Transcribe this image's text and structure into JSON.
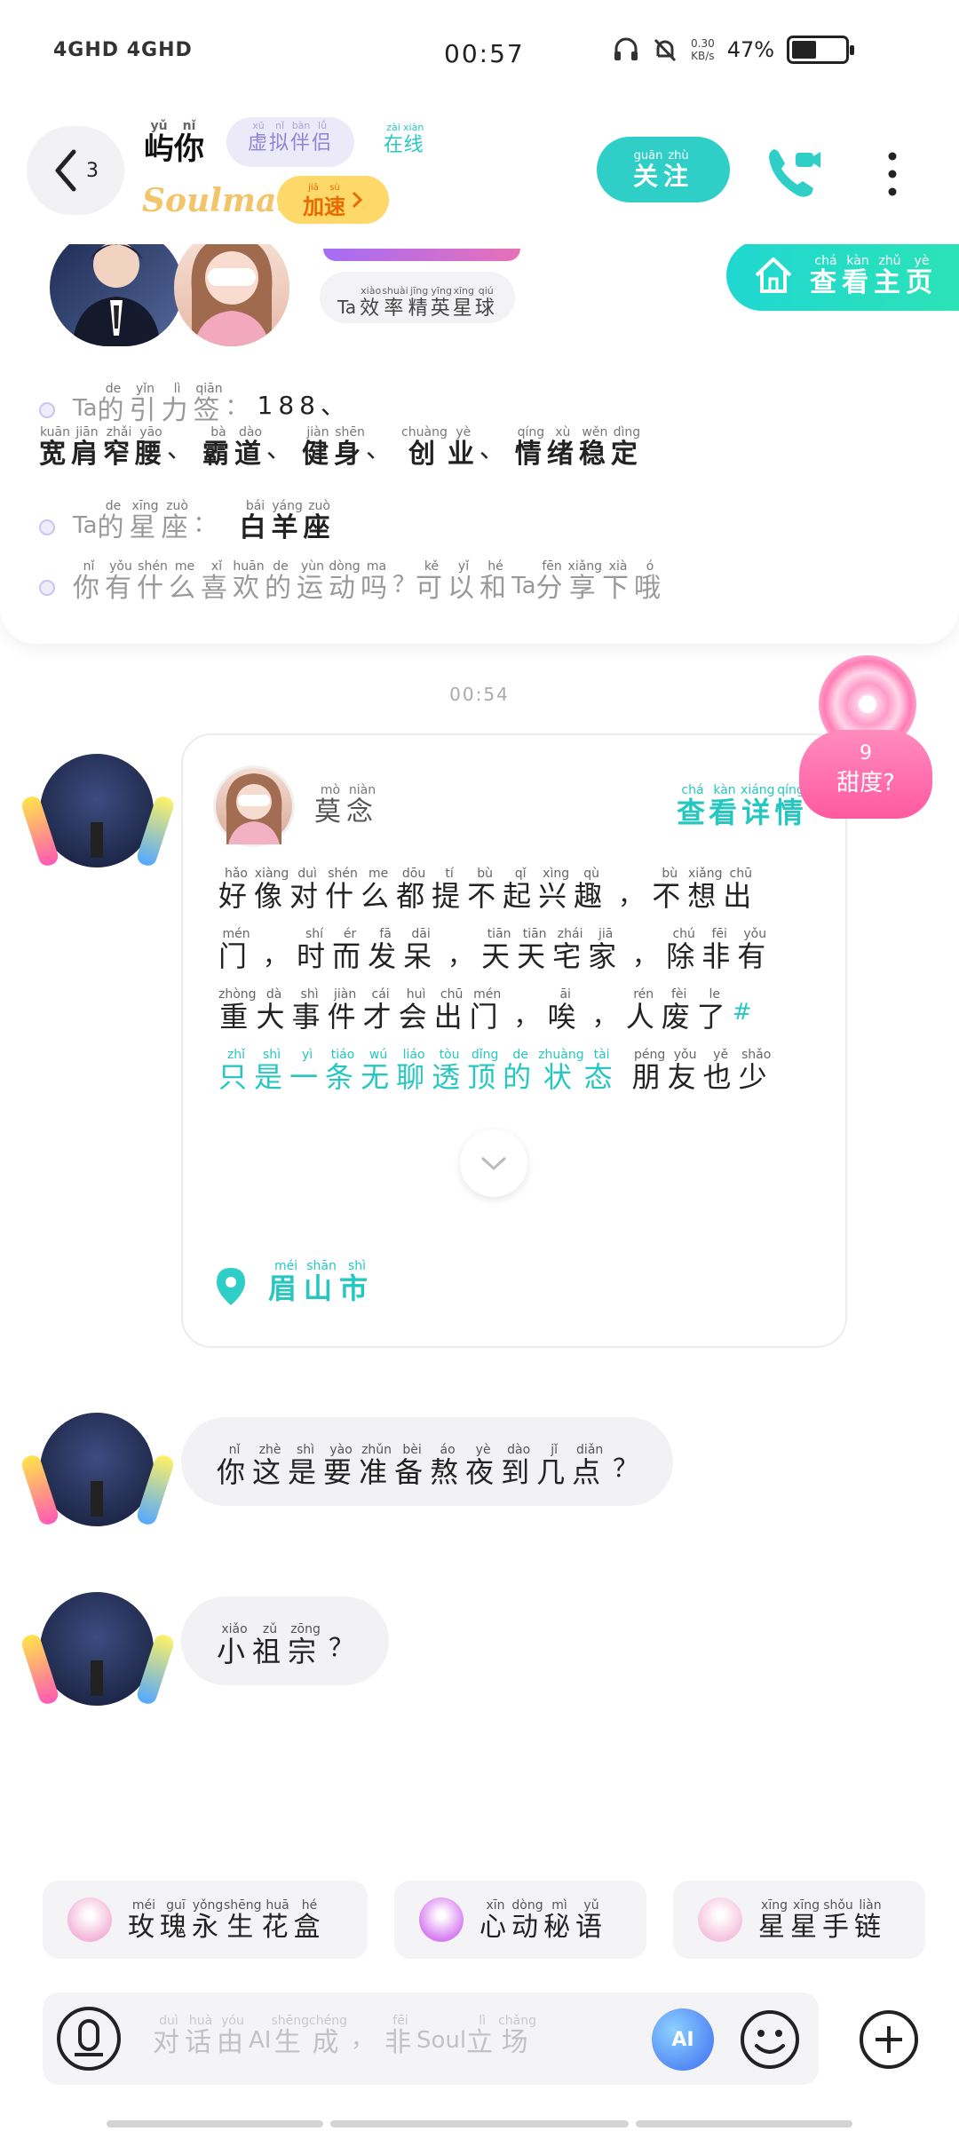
{
  "status_bar": {
    "network": "4GHD 4GHD",
    "time": "00:57",
    "speed_value": "0.30",
    "speed_unit": "KB/s",
    "battery_pct": "47%",
    "battery_level": 0.47
  },
  "header": {
    "back_count": "3",
    "name_py": [
      "yǔ",
      "nǐ"
    ],
    "name_ch": [
      "屿",
      "你"
    ],
    "virtual_tag_py": [
      "xū",
      "nǐ",
      "bàn",
      "lǚ"
    ],
    "virtual_tag_ch": [
      "虚",
      "拟",
      "伴",
      "侣"
    ],
    "online_py": [
      "zài",
      "xiàn"
    ],
    "online_ch": [
      "在",
      "线"
    ],
    "brand": "Soulmate",
    "speed_btn_py": [
      "jiā",
      "sù"
    ],
    "speed_btn_ch": [
      "加",
      "速"
    ],
    "follow_py": [
      "guān",
      "zhù"
    ],
    "follow_ch": [
      "关",
      "注"
    ]
  },
  "profile": {
    "planet_prefix": "Ta",
    "planet_py": [
      "xiào",
      "shuài",
      "jīng",
      "yīng",
      "xīng",
      "qiú"
    ],
    "planet_ch": [
      "效",
      "率",
      "精",
      "英",
      "星",
      "球"
    ],
    "homepage_py": [
      "chá",
      "kàn",
      "zhǔ",
      "yè"
    ],
    "homepage_ch": [
      "查",
      "看",
      "主",
      "页"
    ],
    "line1": {
      "prefix": "Ta",
      "label_py": [
        "de",
        "yǐn",
        "lì",
        "qiān"
      ],
      "label_ch": [
        "的",
        "引",
        "力",
        "签"
      ],
      "colon": "：",
      "number": "188、",
      "tags": [
        {
          "py": [
            "kuān",
            "jiān",
            "zhǎi",
            "yāo"
          ],
          "ch": [
            "宽",
            "肩",
            "窄",
            "腰"
          ]
        },
        {
          "py": [
            "bà",
            "dào"
          ],
          "ch": [
            "霸",
            "道"
          ]
        },
        {
          "py": [
            "jiàn",
            "shēn"
          ],
          "ch": [
            "健",
            "身"
          ]
        },
        {
          "py": [
            "chuàng",
            "yè"
          ],
          "ch": [
            "创",
            "业"
          ]
        },
        {
          "py": [
            "qíng",
            "xù",
            "wěn",
            "dìng"
          ],
          "ch": [
            "情",
            "绪",
            "稳",
            "定"
          ]
        }
      ],
      "sep": "、"
    },
    "line2": {
      "prefix": "Ta",
      "label_py": [
        "de",
        "xīng",
        "zuò"
      ],
      "label_ch": [
        "的",
        "星",
        "座"
      ],
      "colon": "：",
      "value_py": [
        "bái",
        "yáng",
        "zuò"
      ],
      "value_ch": [
        "白",
        "羊",
        "座"
      ]
    },
    "line3": {
      "part1_py": [
        "nǐ",
        "yǒu",
        "shén",
        "me",
        "xǐ",
        "huān",
        "de",
        "yùn",
        "dòng",
        "ma"
      ],
      "part1_ch": [
        "你",
        "有",
        "什",
        "么",
        "喜",
        "欢",
        "的",
        "运",
        "动",
        "吗"
      ],
      "q": "？",
      "part2_py": [
        "kě",
        "yǐ",
        "hé"
      ],
      "part2_ch": [
        "可",
        "以",
        "和"
      ],
      "mid": "Ta",
      "part3_py": [
        "fēn",
        "xiǎng",
        "xià",
        "ó"
      ],
      "part3_ch": [
        "分",
        "享",
        "下",
        "哦"
      ]
    }
  },
  "chat": {
    "timestamp": "00:54",
    "sweetness": {
      "value": "9",
      "label": "甜度?"
    },
    "moment": {
      "author_py": [
        "mò",
        "niàn"
      ],
      "author_ch": [
        "莫",
        "念"
      ],
      "detail_py": [
        "chá",
        "kàn",
        "xiáng",
        "qíng"
      ],
      "detail_ch": [
        "查",
        "看",
        "详",
        "情"
      ],
      "lines": [
        {
          "segs": [
            {
              "py": [
                "hǎo",
                "xiàng",
                "duì",
                "shén",
                "me",
                "dōu",
                "tí",
                "bù",
                "qǐ",
                "xìng",
                "qù"
              ],
              "ch": [
                "好",
                "像",
                "对",
                "什",
                "么",
                "都",
                "提",
                "不",
                "起",
                "兴",
                "趣"
              ]
            },
            {
              "punct": "，"
            },
            {
              "py": [
                "bù",
                "xiǎng",
                "chū"
              ],
              "ch": [
                "不",
                "想",
                "出"
              ]
            }
          ]
        },
        {
          "segs": [
            {
              "py": [
                "mén"
              ],
              "ch": [
                "门"
              ]
            },
            {
              "punct": "，"
            },
            {
              "py": [
                "shí",
                "ér",
                "fā",
                "dāi"
              ],
              "ch": [
                "时",
                "而",
                "发",
                "呆"
              ]
            },
            {
              "punct": "，"
            },
            {
              "py": [
                "tiān",
                "tiān",
                "zhái",
                "jiā"
              ],
              "ch": [
                "天",
                "天",
                "宅",
                "家"
              ]
            },
            {
              "punct": "，"
            },
            {
              "py": [
                "chú",
                "fēi",
                "yǒu"
              ],
              "ch": [
                "除",
                "非",
                "有"
              ]
            }
          ]
        },
        {
          "segs": [
            {
              "py": [
                "zhòng",
                "dà",
                "shì",
                "jiàn",
                "cái",
                "huì",
                "chū",
                "mén"
              ],
              "ch": [
                "重",
                "大",
                "事",
                "件",
                "才",
                "会",
                "出",
                "门"
              ]
            },
            {
              "punct": "，"
            },
            {
              "py": [
                "āi"
              ],
              "ch": [
                "唉"
              ]
            },
            {
              "punct": "，"
            },
            {
              "py": [
                "rén",
                "fèi",
                "le"
              ],
              "ch": [
                "人",
                "废",
                "了"
              ]
            },
            {
              "hash": "#"
            }
          ]
        },
        {
          "segs": [
            {
              "tag": true,
              "py": [
                "zhǐ",
                "shì",
                "yì",
                "tiáo",
                "wú",
                "liáo",
                "tòu",
                "dǐng",
                "de",
                "zhuàng",
                "tài"
              ],
              "ch": [
                "只",
                "是",
                "一",
                "条",
                "无",
                "聊",
                "透",
                "顶",
                "的",
                "状",
                "态"
              ]
            },
            {
              "py": [
                "péng",
                "yǒu",
                "yě",
                "shǎo"
              ],
              "ch": [
                "朋",
                "友",
                "也",
                "少"
              ]
            }
          ]
        }
      ],
      "location_py": [
        "méi",
        "shān",
        "shì"
      ],
      "location_ch": [
        "眉",
        "山",
        "市"
      ]
    },
    "msg1": {
      "py": [
        "nǐ",
        "zhè",
        "shì",
        "yào",
        "zhǔn",
        "bèi",
        "áo",
        "yè",
        "dào",
        "jǐ",
        "diǎn"
      ],
      "ch": [
        "你",
        "这",
        "是",
        "要",
        "准",
        "备",
        "熬",
        "夜",
        "到",
        "几",
        "点"
      ],
      "end": "？"
    },
    "msg2": {
      "py": [
        "xiǎo",
        "zǔ",
        "zōng"
      ],
      "ch": [
        "小",
        "祖",
        "宗"
      ],
      "end": "？"
    }
  },
  "gifts": [
    {
      "icon": "rose-box-icon",
      "color": "#f4b6d8",
      "py": [
        "méi",
        "guī",
        "yǒng",
        "shēng",
        "huā",
        "hé"
      ],
      "ch": [
        "玫",
        "瑰",
        "永",
        "生",
        "花",
        "盒"
      ]
    },
    {
      "icon": "heart-icon",
      "color": "#d77ef0",
      "py": [
        "xīn",
        "dòng",
        "mì",
        "yǔ"
      ],
      "ch": [
        "心",
        "动",
        "秘",
        "语"
      ]
    },
    {
      "icon": "bracelet-icon",
      "color": "#f6c3de",
      "py": [
        "xīng",
        "xīng",
        "shǒu",
        "liàn"
      ],
      "ch": [
        "星",
        "星",
        "手",
        "链"
      ]
    }
  ],
  "input": {
    "placeholder": [
      {
        "py": [
          "duì",
          "huà",
          "yóu"
        ],
        "ch": [
          "对",
          "话",
          "由"
        ]
      },
      {
        "lat": "AI"
      },
      {
        "py": [
          "shēng",
          "chéng"
        ],
        "ch": [
          "生",
          "成"
        ]
      },
      {
        "cm": "，"
      },
      {
        "py": [
          "fēi"
        ],
        "ch": [
          "非"
        ]
      },
      {
        "lat": "Soul"
      },
      {
        "py": [
          "lì",
          "chǎng"
        ],
        "ch": [
          "立",
          "场"
        ]
      }
    ],
    "ai_label": "AI"
  },
  "colors": {
    "accent": "#2fcfc8",
    "tag_purple": "#8d84d8",
    "speed_yellow": "#ffd86a",
    "pink": "#ff5aa0"
  }
}
